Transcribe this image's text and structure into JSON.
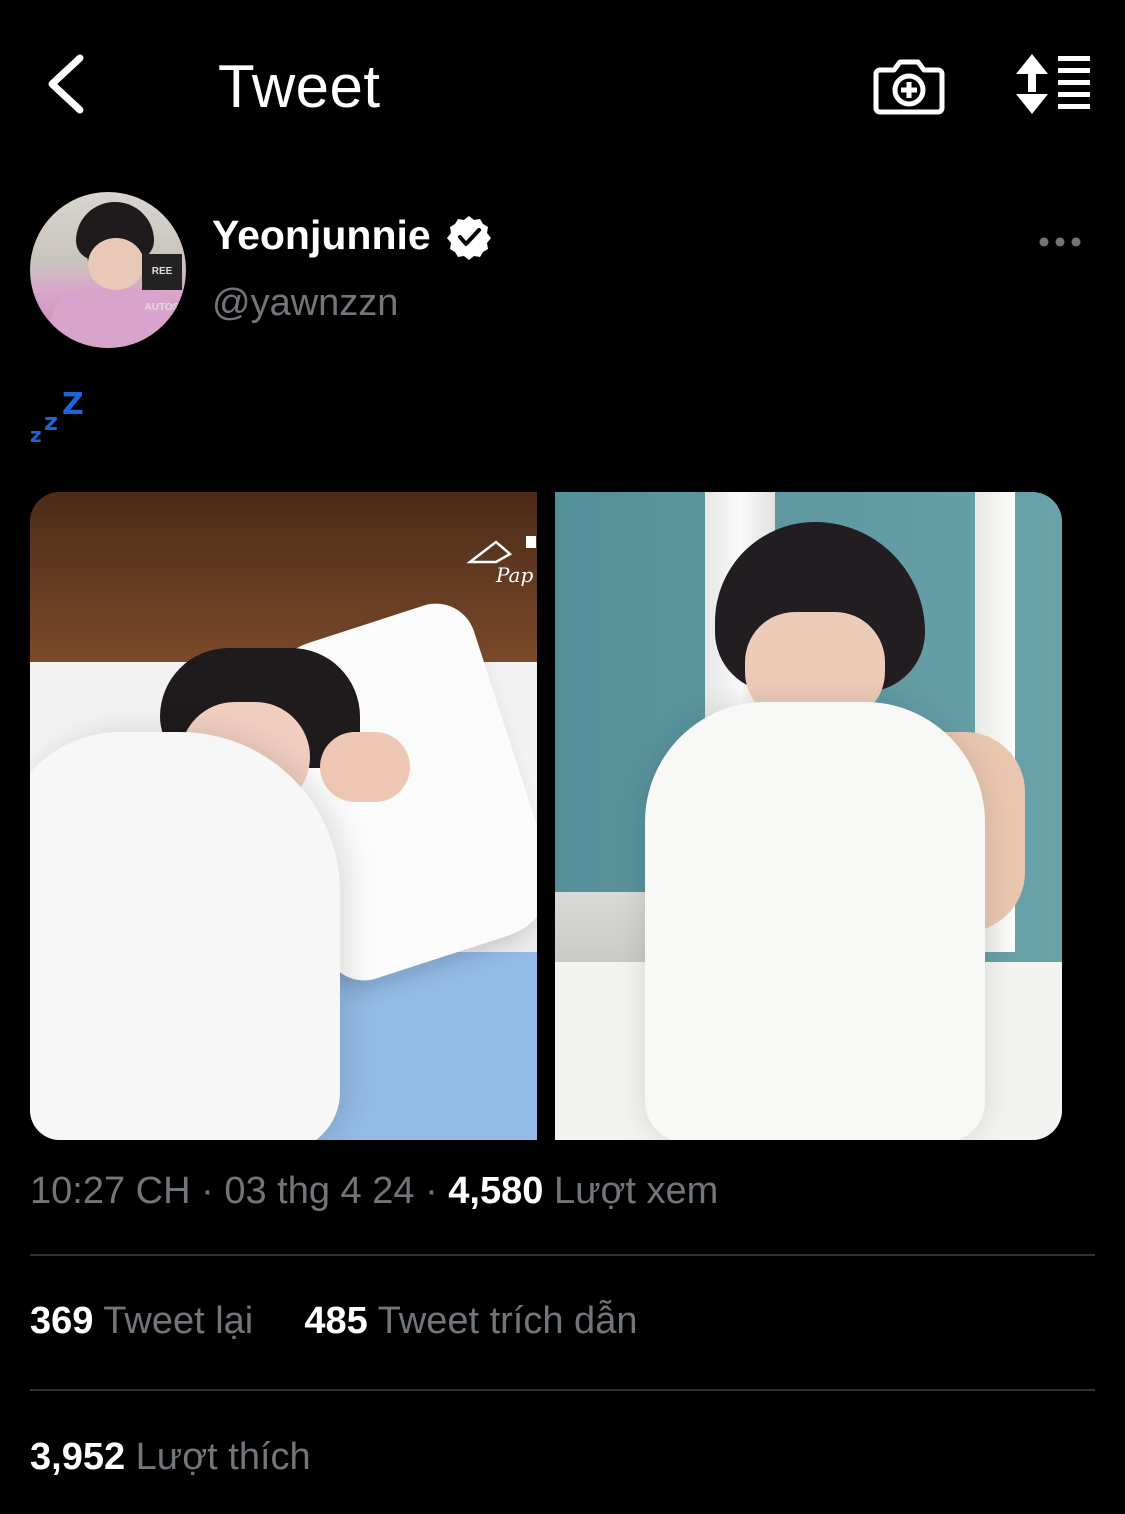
{
  "header": {
    "title": "Tweet",
    "back_icon": "chevron-left-icon",
    "camera_icon": "camera-plus-icon",
    "sort_icon": "sort-list-icon"
  },
  "author": {
    "display_name": "Yeonjunnie",
    "handle": "@yawnzzn",
    "verified": true,
    "avatar_sign_text": "REE AUTOS"
  },
  "tweet": {
    "emoji": "💤",
    "media_count": 2,
    "watermark_text": "Pap"
  },
  "meta": {
    "time": "10:27 CH",
    "separator": "·",
    "date": "03 thg 4 24",
    "views_count": "4,580",
    "views_label": "Lượt xem"
  },
  "stats": {
    "retweets_count": "369",
    "retweets_label": "Tweet lại",
    "quotes_count": "485",
    "quotes_label": "Tweet trích dẫn",
    "likes_count": "3,952",
    "likes_label": "Lượt thích"
  },
  "colors": {
    "background": "#000000",
    "text_primary": "#ffffff",
    "text_secondary": "#71767b",
    "divider": "#2f3336",
    "emoji_blue": "#1d64d8"
  }
}
